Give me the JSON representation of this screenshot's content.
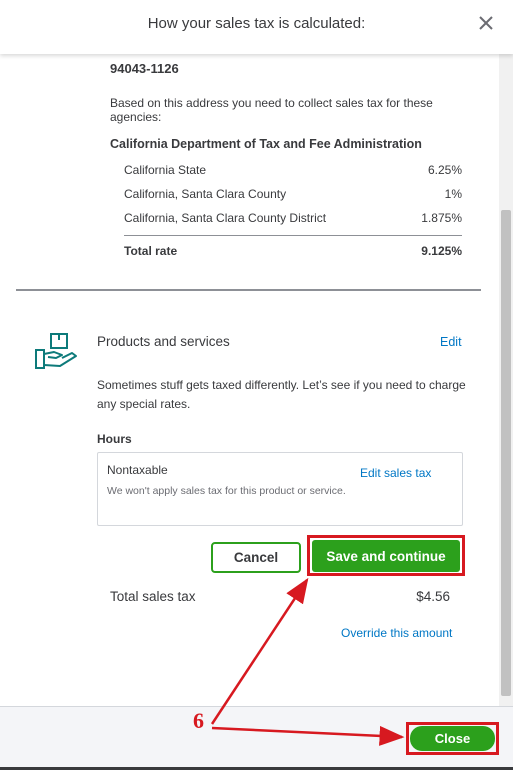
{
  "dialog": {
    "title": "How your sales tax is calculated:"
  },
  "address": {
    "zip": "94043-1126"
  },
  "agencies_intro": "Based on this address you need to collect sales tax for these agencies:",
  "agency": {
    "name": "California Department of Tax and Fee Administration",
    "rates": [
      {
        "label": "California State",
        "value": "6.25%"
      },
      {
        "label": "California, Santa Clara County",
        "value": "1%"
      },
      {
        "label": "California, Santa Clara County District",
        "value": "1.875%"
      }
    ],
    "total_label": "Total rate",
    "total_value": "9.125%"
  },
  "products": {
    "title": "Products and services",
    "edit_label": "Edit",
    "description": "Sometimes stuff gets taxed differently. Let’s see if you need to charge any special rates.",
    "item_label": "Hours",
    "card": {
      "status": "Nontaxable",
      "description": "We won't apply sales tax for this product or service.",
      "edit_label": "Edit sales tax"
    }
  },
  "buttons": {
    "cancel": "Cancel",
    "save": "Save and continue",
    "close": "Close"
  },
  "totals": {
    "label": "Total sales tax",
    "value": "$4.56",
    "override_label": "Override this amount"
  },
  "annotation": {
    "step_number": "6",
    "color": "#d71920"
  },
  "colors": {
    "primary_green": "#2ca01c",
    "link_blue": "#0077c5",
    "text": "#393a3d",
    "icon_teal": "#0d7a7a"
  },
  "icons": [
    "close-icon",
    "box-in-hand-icon"
  ]
}
